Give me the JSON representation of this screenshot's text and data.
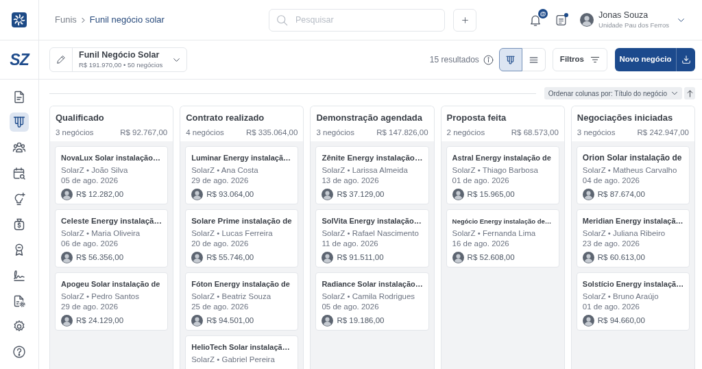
{
  "top_bar": {
    "breadcrumb": [
      {
        "label": "Funis",
        "current": false
      },
      {
        "label": "Funil negócio solar",
        "current": true
      }
    ],
    "search": {
      "placeholder": "Pesquisar"
    },
    "mention_badge": "@",
    "notes_unread": true,
    "user": {
      "name": "Jonas Souza",
      "unit": "Unidade Pau dos Ferros"
    }
  },
  "sidebar": {
    "logo": "SZ",
    "items": [
      {
        "kind": "document",
        "selected": false
      },
      {
        "kind": "kanban",
        "selected": true
      },
      {
        "kind": "people",
        "selected": false
      },
      {
        "kind": "calendar",
        "selected": false
      },
      {
        "kind": "idea",
        "selected": false
      },
      {
        "kind": "money",
        "selected": false
      },
      {
        "kind": "award",
        "selected": false
      },
      {
        "kind": "signature",
        "selected": false
      },
      {
        "kind": "file",
        "selected": false
      },
      {
        "kind": "settings",
        "selected": false
      },
      {
        "kind": "help",
        "selected": false
      }
    ]
  },
  "toolbar": {
    "funnel": {
      "name": "Funil Negócio Solar",
      "summary": "R$ 191.970,00 • 50 negócios"
    },
    "results": "15 resultados",
    "views": [
      {
        "kind": "kanban",
        "selected": true
      },
      {
        "kind": "list",
        "selected": false
      }
    ],
    "filter_button": "Filtros",
    "new_button": "Novo negócio"
  },
  "sort": {
    "label": "Ordenar colunas por: Título do negócio"
  },
  "columns": [
    {
      "title": "Qualificado",
      "count": "3 negócios",
      "total": "R$ 92.767,00",
      "cards": [
        {
          "title": "NovaLux Solar instalação…",
          "meta": "SolarZ • João Silva",
          "date": "05 de ago. 2026",
          "value": "R$ 12.282,00"
        },
        {
          "title": "Celeste Energy instalaçã…",
          "meta": "SolarZ • Maria Oliveira",
          "date": "06 de ago. 2026",
          "value": "R$ 56.356,00"
        },
        {
          "title": "Apogeu Solar instalação de",
          "meta": "SolarZ • Pedro Santos",
          "date": "29 de ago. 2026",
          "value": "R$ 24.129,00"
        }
      ]
    },
    {
      "title": "Contrato realizado",
      "count": "4 negócios",
      "total": "R$ 335.064,00",
      "cards": [
        {
          "title": "Luminar Energy instalaçã…",
          "meta": "SolarZ • Ana Costa",
          "date": "29 de ago. 2026",
          "value": "R$ 93.064,00"
        },
        {
          "title": "Solare Prime instalação de",
          "meta": "SolarZ • Lucas Ferreira",
          "date": "20 de ago. 2026",
          "value": "R$ 55.746,00"
        },
        {
          "title": "Fóton Energy instalação de",
          "meta": "SolarZ • Beatriz Souza",
          "date": "25 de ago. 2026",
          "value": "R$ 94.501,00"
        },
        {
          "title": "HelioTech Solar instalaçã…",
          "meta": "SolarZ • Gabriel Pereira"
        }
      ]
    },
    {
      "title": "Demonstração agendada",
      "count": "3 negócios",
      "total": "R$ 147.826,00",
      "cards": [
        {
          "title": "Zênite Energy instalação…",
          "meta": "SolarZ • Larissa Almeida",
          "date": "13 de ago. 2026",
          "value": "R$ 37.129,00"
        },
        {
          "title": "SolVita Energy instalação…",
          "meta": "SolarZ • Rafael Nascimento",
          "date": "11 de ago. 2026",
          "value": "R$ 91.511,00"
        },
        {
          "title": "Radiance Solar instalação…",
          "meta": "SolarZ • Camila Rodrigues",
          "date": "05 de ago. 2026",
          "value": "R$ 19.186,00"
        }
      ]
    },
    {
      "title": "Proposta feita",
      "count": "2 negócios",
      "total": "R$ 68.573,00",
      "cards": [
        {
          "title": "Astral Energy instalação de",
          "meta": "SolarZ • Thiago Barbosa",
          "date": "01 de ago. 2026",
          "value": "R$ 15.965,00"
        },
        {
          "title": "Negócio Energy instalação de…",
          "meta": "SolarZ • Fernanda Lima",
          "date": "16 de ago. 2026",
          "value": "R$ 52.608,00"
        }
      ]
    },
    {
      "title": "Negociações iniciadas",
      "count": "3 negócios",
      "total": "R$ 242.947,00",
      "cards": [
        {
          "title": "Orion Solar instalação de",
          "meta": "SolarZ • Matheus Carvalho",
          "date": "04 de ago. 2026",
          "value": "R$ 87.674,00"
        },
        {
          "title": "Meridian Energy instalaçã…",
          "meta": "SolarZ • Juliana Ribeiro",
          "date": "23 de ago. 2026",
          "value": "R$ 60.613,00"
        },
        {
          "title": "Solstício Energy instalaçã…",
          "meta": "SolarZ • Bruno Araújo",
          "date": "01 de ago. 2026",
          "value": "R$ 94.660,00"
        }
      ]
    }
  ]
}
